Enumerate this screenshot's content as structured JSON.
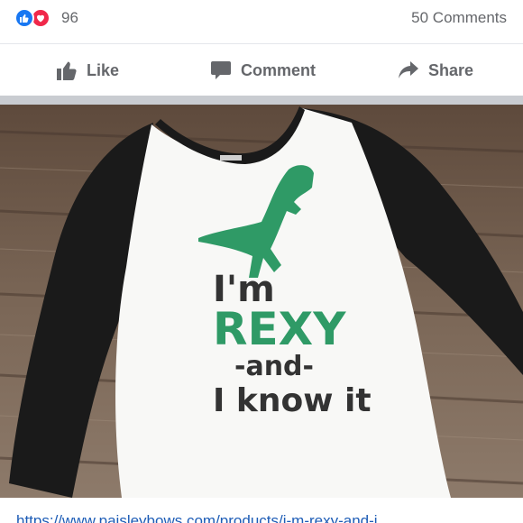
{
  "reactions": {
    "icons": [
      "like-icon",
      "love-icon"
    ],
    "like_color": "#1877f2",
    "love_color": "#f0284a",
    "count": "96",
    "comments": "50 Comments"
  },
  "actions": {
    "like_label": "Like",
    "comment_label": "Comment",
    "share_label": "Share",
    "icon_color": "#65676b"
  },
  "photo": {
    "shirt_text_line1": "I'm",
    "shirt_text_line2": "REXY",
    "shirt_text_line3": "-and-",
    "shirt_text_line4": "I know it",
    "accent_color": "#2f9a66"
  },
  "link": {
    "url_text": "https://www.paisleybows.com/products/i-m-rexy-and-i"
  }
}
